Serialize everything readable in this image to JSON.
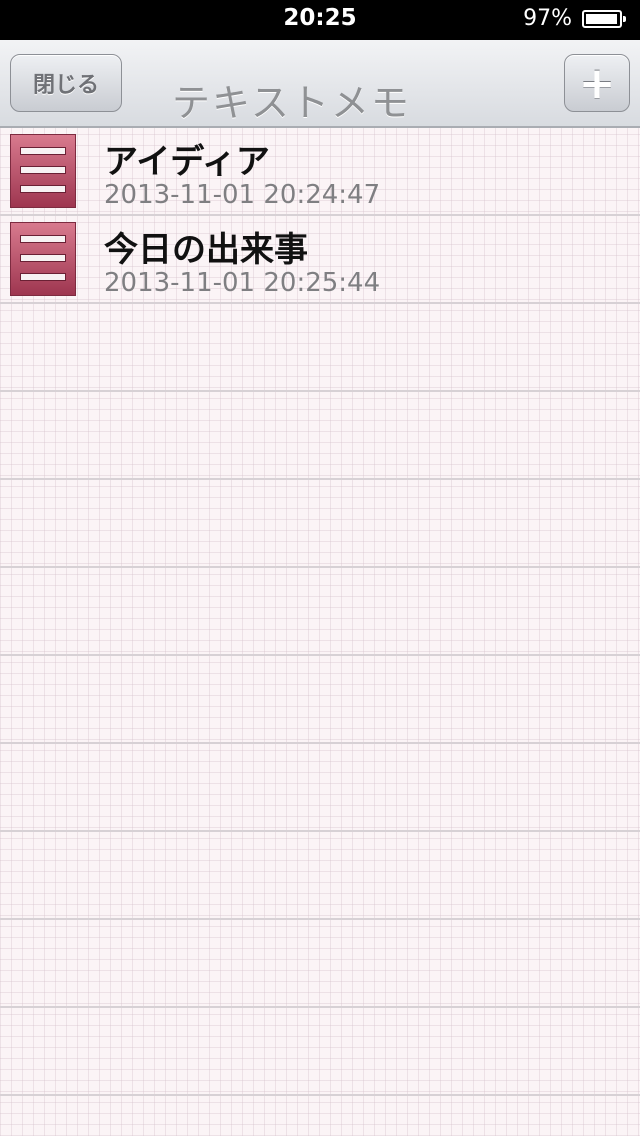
{
  "status_bar": {
    "time": "20:25",
    "battery_percent": "97%",
    "battery_level": 0.97
  },
  "nav": {
    "close_label": "閉じる",
    "title": "テキストメモ",
    "add_label": "+"
  },
  "memos": [
    {
      "title": "アイディア",
      "date": "2013-11-01 20:24:47"
    },
    {
      "title": "今日の出来事",
      "date": "2013-11-01 20:25:44"
    }
  ],
  "icons": {
    "memo": "memo-list-icon",
    "battery": "battery-icon",
    "add": "plus-icon"
  }
}
